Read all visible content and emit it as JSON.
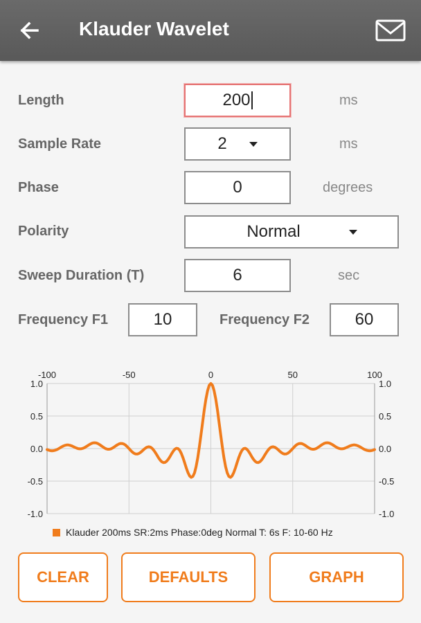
{
  "app_bar": {
    "title": "Klauder Wavelet",
    "back_icon": "arrow-back-icon",
    "mail_icon": "mail-icon"
  },
  "form": {
    "length": {
      "label": "Length",
      "value": "200",
      "unit": "ms"
    },
    "sample_rate": {
      "label": "Sample Rate",
      "value": "2",
      "unit": "ms"
    },
    "phase": {
      "label": "Phase",
      "value": "0",
      "unit": "degrees"
    },
    "polarity": {
      "label": "Polarity",
      "value": "Normal"
    },
    "sweep_duration": {
      "label": "Sweep Duration (T)",
      "value": "6",
      "unit": "sec"
    },
    "f1": {
      "label": "Frequency F1",
      "value": "10"
    },
    "f2": {
      "label": "Frequency F2",
      "value": "60"
    }
  },
  "chart_data": {
    "type": "line",
    "x_range": [
      -100,
      100
    ],
    "y_range": [
      -1.0,
      1.0
    ],
    "x_ticks": [
      "-100",
      "-50",
      "0",
      "50",
      "100"
    ],
    "y_ticks": [
      "1.0",
      "0.5",
      "0.0",
      "-0.5",
      "-1.0"
    ],
    "grid": true,
    "legend": "Klauder 200ms SR:2ms Phase:0deg Normal T: 6s F: 10-60 Hz",
    "series_color": "#f07c1c",
    "wavelet": {
      "length_ms": 200,
      "sample_rate_ms": 2,
      "f1": 10,
      "f2": 60,
      "sweep_s": 6
    }
  },
  "buttons": {
    "clear": "CLEAR",
    "defaults": "DEFAULTS",
    "graph": "GRAPH"
  }
}
